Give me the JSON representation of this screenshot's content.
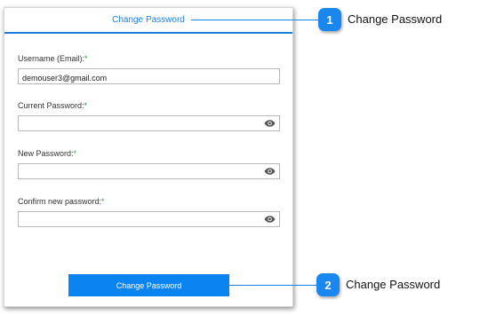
{
  "form": {
    "title": "Change Password",
    "fields": [
      {
        "label": "Username (Email):",
        "required": "*",
        "value": "demouser3@gmail.com",
        "type": "text"
      },
      {
        "label": "Current Password:",
        "required": "*",
        "value": "",
        "type": "password"
      },
      {
        "label": "New Password:",
        "required": "*",
        "value": "",
        "type": "password"
      },
      {
        "label": "Confirm new password:",
        "required": "*",
        "value": "",
        "type": "password"
      }
    ],
    "submit_label": "Change Password"
  },
  "callouts": [
    {
      "number": "1",
      "label": "Change Password"
    },
    {
      "number": "2",
      "label": "Change Password"
    }
  ],
  "colors": {
    "accent": "#1a7fd9",
    "button": "#0b84f2",
    "required": "#2e9e3e"
  },
  "icons": {
    "password_toggle": "eye-icon"
  }
}
